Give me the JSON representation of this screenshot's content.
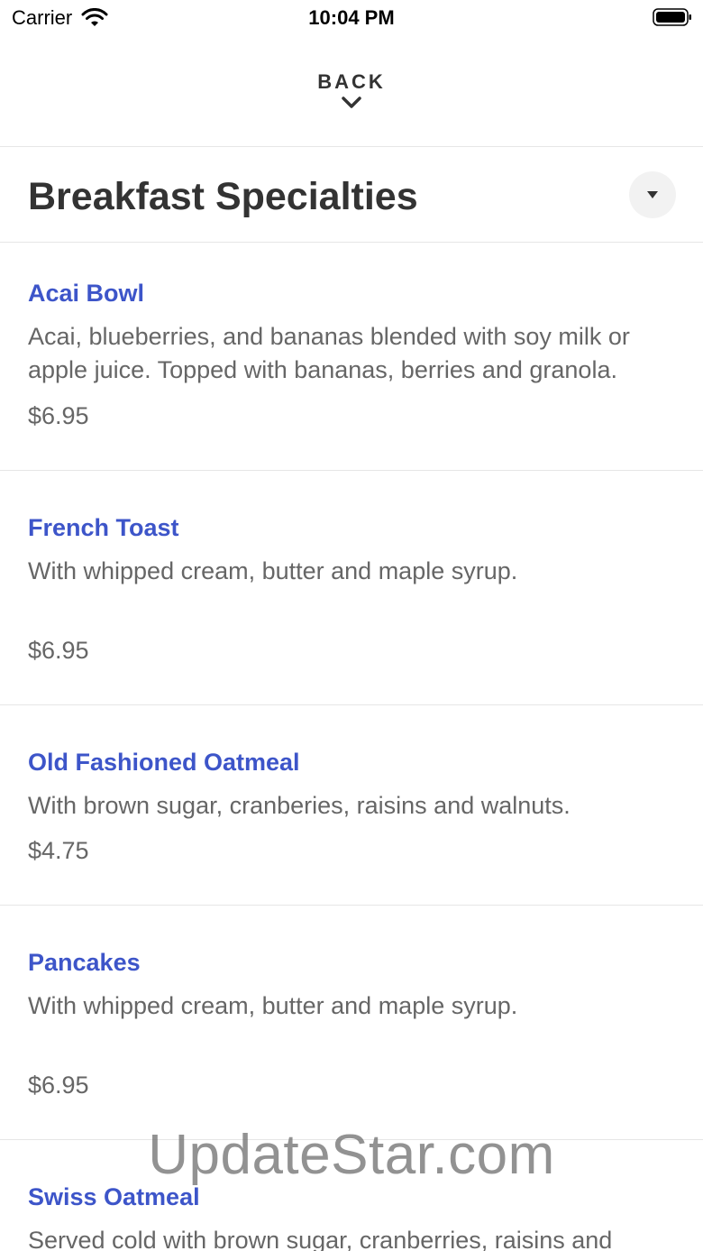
{
  "status_bar": {
    "carrier": "Carrier",
    "time": "10:04 PM",
    "wifi_icon": "wifi-icon",
    "battery_icon": "battery-icon"
  },
  "nav": {
    "back_label": "BACK",
    "back_icon": "chevron-down-icon"
  },
  "section": {
    "title": "Breakfast Specialties",
    "toggle_icon": "caret-down-icon"
  },
  "items": [
    {
      "name": "Acai Bowl",
      "description": "Acai, blueberries, and bananas blended with  soy milk or apple juice. Topped with bananas, berries and granola.",
      "price": "$6.95"
    },
    {
      "name": "French Toast",
      "description": "With whipped cream, butter and maple syrup.",
      "price": "$6.95"
    },
    {
      "name": "Old Fashioned Oatmeal",
      "description": "With brown sugar, cranberies, raisins and walnuts.",
      "price": "$4.75"
    },
    {
      "name": "Pancakes",
      "description": "With whipped cream, butter and maple syrup.",
      "price": "$6.95"
    },
    {
      "name": "Swiss Oatmeal",
      "description": "Served cold with brown sugar, cranberries, raisins and"
    }
  ],
  "watermark": "UpdateStar.com",
  "colors": {
    "item_name": "#3d55c9",
    "text_secondary": "#666666",
    "title": "#333333",
    "divider": "#e6e6e6"
  }
}
